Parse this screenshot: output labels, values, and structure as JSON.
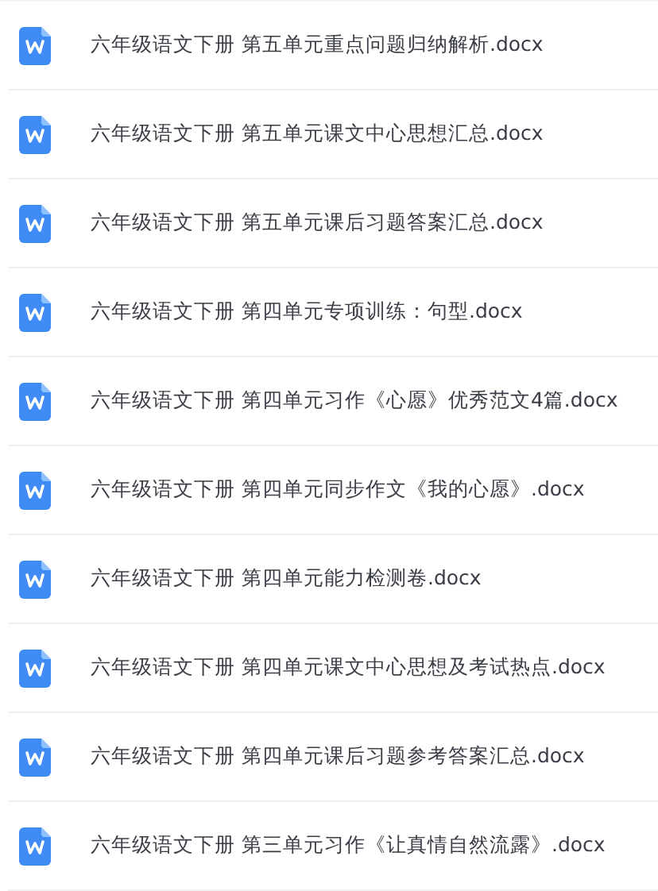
{
  "files": [
    {
      "name": "六年级语文下册 第五单元重点问题归纳解析.docx"
    },
    {
      "name": "六年级语文下册 第五单元课文中心思想汇总.docx"
    },
    {
      "name": "六年级语文下册 第五单元课后习题答案汇总.docx"
    },
    {
      "name": "六年级语文下册 第四单元专项训练：句型.docx"
    },
    {
      "name": "六年级语文下册 第四单元习作《心愿》优秀范文4篇.docx"
    },
    {
      "name": "六年级语文下册 第四单元同步作文《我的心愿》.docx"
    },
    {
      "name": "六年级语文下册 第四单元能力检测卷.docx"
    },
    {
      "name": "六年级语文下册 第四单元课文中心思想及考试热点.docx"
    },
    {
      "name": "六年级语文下册 第四单元课后习题参考答案汇总.docx"
    },
    {
      "name": "六年级语文下册 第三单元习作《让真情自然流露》.docx"
    }
  ]
}
